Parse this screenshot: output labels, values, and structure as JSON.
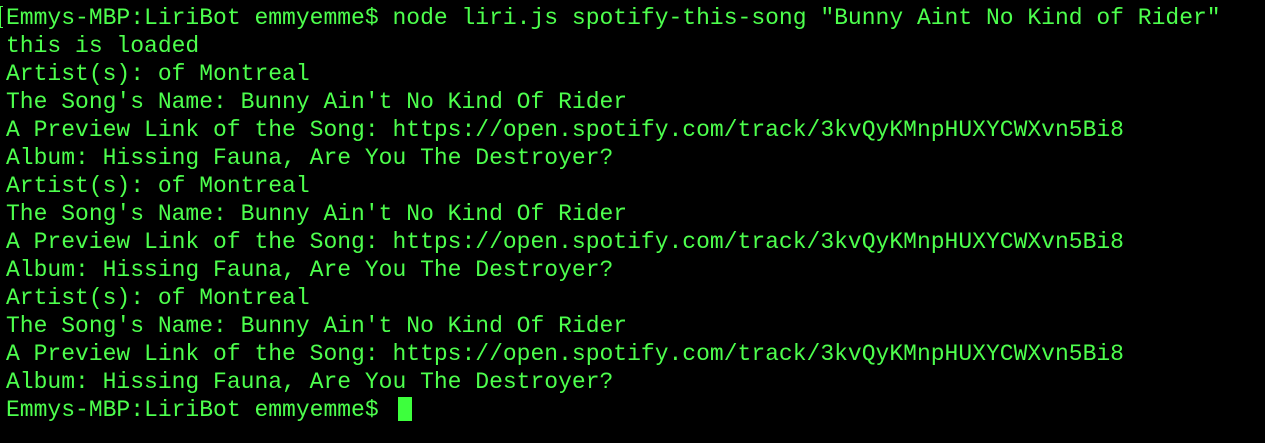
{
  "terminal": {
    "lines": [
      "Emmys-MBP:LiriBot emmyemme$ node liri.js spotify-this-song \"Bunny Aint No Kind of Rider\"",
      "this is loaded",
      "Artist(s): of Montreal",
      "The Song's Name: Bunny Ain't No Kind Of Rider",
      "A Preview Link of the Song: https://open.spotify.com/track/3kvQyKMnpHUXYCWXvn5Bi8",
      "Album: Hissing Fauna, Are You The Destroyer?",
      "Artist(s): of Montreal",
      "The Song's Name: Bunny Ain't No Kind Of Rider",
      "A Preview Link of the Song: https://open.spotify.com/track/3kvQyKMnpHUXYCWXvn5Bi8",
      "Album: Hissing Fauna, Are You The Destroyer?",
      "Artist(s): of Montreal",
      "The Song's Name: Bunny Ain't No Kind Of Rider",
      "A Preview Link of the Song: https://open.spotify.com/track/3kvQyKMnpHUXYCWXvn5Bi8",
      "Album: Hissing Fauna, Are You The Destroyer?"
    ],
    "prompt": "Emmys-MBP:LiriBot emmyemme$ "
  },
  "colors": {
    "background": "#000000",
    "text": "#4dff4d",
    "cursor": "#3dff3d"
  }
}
